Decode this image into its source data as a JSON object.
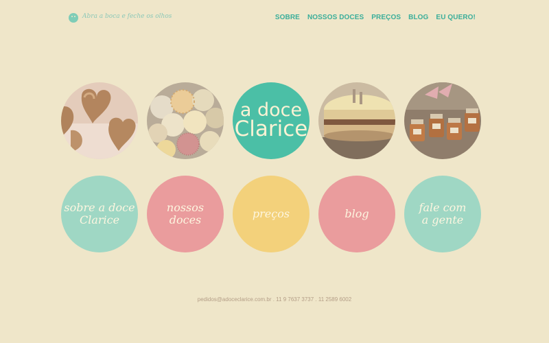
{
  "header": {
    "tagline": "Abra a boca e feche os olhos",
    "logo_icon": "smiley-face-icon",
    "nav": [
      "SOBRE",
      "NOSSOS DOCES",
      "PREÇOS",
      "BLOG",
      "EU QUERO!"
    ]
  },
  "brand": {
    "line1": "a doce",
    "line2": "Clarice"
  },
  "photos": [
    {
      "name": "chocolate-hearts-photo"
    },
    {
      "name": "bonbons-photo"
    },
    {
      "name": "layer-cake-photo"
    },
    {
      "name": "jam-jars-photo"
    }
  ],
  "nav_circles": [
    {
      "label": "sobre a doce\nClarice",
      "color": "#9fd7c4"
    },
    {
      "label": "nossos\ndoces",
      "color": "#ea9c9d"
    },
    {
      "label": "preços",
      "color": "#f3d17b"
    },
    {
      "label": "blog",
      "color": "#ea9c9d"
    },
    {
      "label": "fale com\na gente",
      "color": "#9fd7c4"
    }
  ],
  "footer": {
    "contact": "pedidos@adoceclarice.com.br . 11 9 7637 3737 . 11 2589 6002"
  },
  "colors": {
    "background": "#efe6c9",
    "accent": "#4bbfa6",
    "nav_text": "#3aae9a"
  }
}
